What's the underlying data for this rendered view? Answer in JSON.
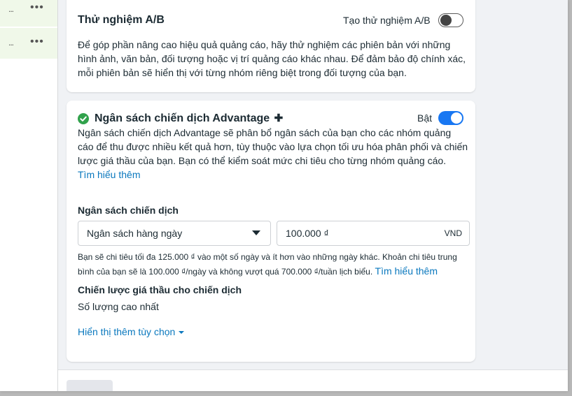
{
  "left_rows": [
    {
      "tick": "...",
      "more": "•••"
    },
    {
      "tick": "...",
      "more": "•••"
    }
  ],
  "ab_test": {
    "title": "Thử nghiệm A/B",
    "toggle_label": "Tạo thử nghiệm A/B",
    "toggle_on": false,
    "line1": "Để góp phần nâng cao hiệu quả quảng cáo, hãy thử nghiệm các phiên bản với những",
    "line2": "hình ảnh, văn bản, đối tượng hoặc vị trí quảng cáo khác nhau. Để đảm bảo độ chính xác,",
    "line3": "mỗi phiên bản sẽ hiển thị với từng nhóm riêng biệt trong đối tượng của bạn."
  },
  "advantage": {
    "title": "Ngân sách chiến dịch Advantage",
    "title_suffix": "✚",
    "toggle_label": "Bật",
    "toggle_on": true,
    "line1": "Ngân sách chiến dịch Advantage sẽ phân bổ ngân sách của bạn cho các nhóm quảng",
    "line2": "cáo để thu được nhiều kết quả hơn, tùy thuộc vào lựa chọn tối ưu hóa phân phối và chiến",
    "line3": "lược giá thầu của bạn. Bạn có thể kiểm soát mức chi tiêu cho từng nhóm quảng cáo.",
    "learn_more": "Tìm hiểu thêm",
    "budget_label": "Ngân sách chiến dịch",
    "budget_type": "Ngân sách hàng ngày",
    "budget_amount": "100.000 ₫",
    "currency": "VND",
    "note_line1": "Bạn sẽ chi tiêu tối đa 125.000 ₫ vào một số ngày và ít hơn vào những ngày khác. Khoản chi tiêu trung",
    "note_line2": "bình của bạn sẽ là 100.000 ₫/ngày và không vượt quá 700.000 ₫/tuần lịch biểu.",
    "note_learn_more": "Tìm hiểu thêm",
    "bid_label": "Chiến lược giá thầu cho chiến dịch",
    "bid_value": "Số lượng cao nhất",
    "show_more": "Hiển thị thêm tùy chọn"
  },
  "colors": {
    "accent": "#1877f2",
    "link": "#0a78be",
    "success": "#31a24c"
  }
}
